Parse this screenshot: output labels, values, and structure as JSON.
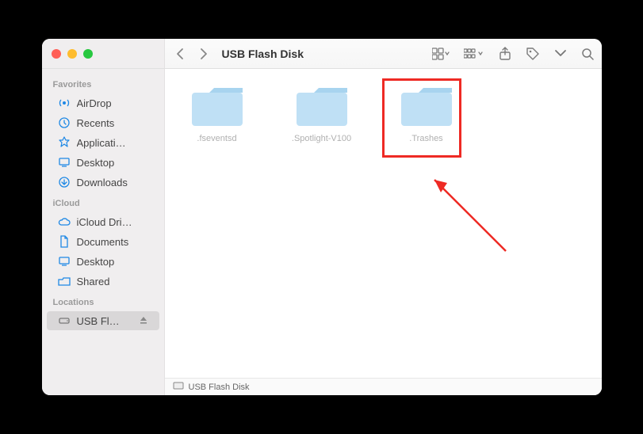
{
  "window_title": "USB Flash Disk",
  "sidebar": {
    "sections": [
      {
        "title": "Favorites",
        "items": [
          {
            "icon": "airdrop",
            "label": "AirDrop"
          },
          {
            "icon": "recents",
            "label": "Recents"
          },
          {
            "icon": "applications",
            "label": "Applicati…"
          },
          {
            "icon": "desktop",
            "label": "Desktop"
          },
          {
            "icon": "downloads",
            "label": "Downloads"
          }
        ]
      },
      {
        "title": "iCloud",
        "items": [
          {
            "icon": "icloud",
            "label": "iCloud Dri…"
          },
          {
            "icon": "document",
            "label": "Documents"
          },
          {
            "icon": "desktop",
            "label": "Desktop"
          },
          {
            "icon": "shared",
            "label": "Shared"
          }
        ]
      },
      {
        "title": "Locations",
        "items": [
          {
            "icon": "disk",
            "label": "USB Fl…",
            "selected": true,
            "ejectable": true
          }
        ]
      }
    ]
  },
  "folders": [
    {
      "name": ".fseventsd"
    },
    {
      "name": ".Spotlight-V100"
    },
    {
      "name": ".Trashes",
      "highlighted": true
    }
  ],
  "pathbar": {
    "icon": "disk",
    "label": "USB Flash Disk"
  }
}
